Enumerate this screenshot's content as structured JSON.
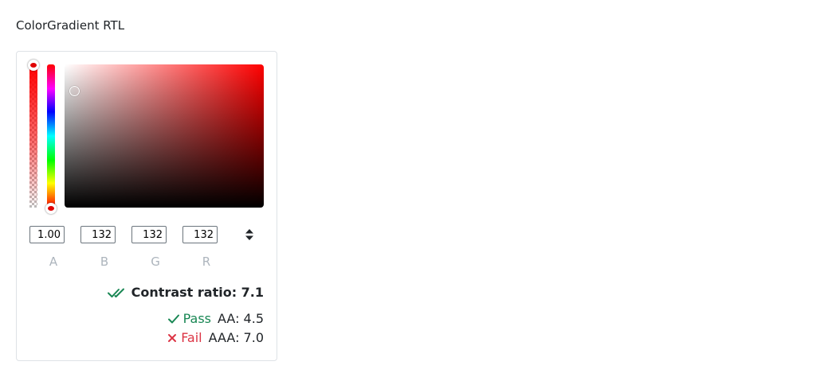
{
  "page": {
    "title": "ColorGradient RTL"
  },
  "picker": {
    "alpha_level": 1.0,
    "hue_degrees": 0,
    "inputs": {
      "a": "1.00",
      "b": "132",
      "g": "132",
      "r": "132"
    },
    "labels": {
      "a": "A",
      "b": "B",
      "g": "G",
      "r": "R"
    },
    "format_toggle_icon": "sort-arrows-icon"
  },
  "contrast": {
    "label": "Contrast ratio: 7.1",
    "icon": "double-check-icon",
    "aa": {
      "status": "Pass",
      "level_text": "AA: 4.5",
      "icon": "check-icon"
    },
    "aaa": {
      "status": "Fail",
      "level_text": "AAA: 7.0",
      "icon": "cross-icon"
    }
  },
  "colors": {
    "pass": "#198754",
    "fail": "#dc3545",
    "hue": "#ff0000",
    "label_muted": "#adb5bd"
  }
}
